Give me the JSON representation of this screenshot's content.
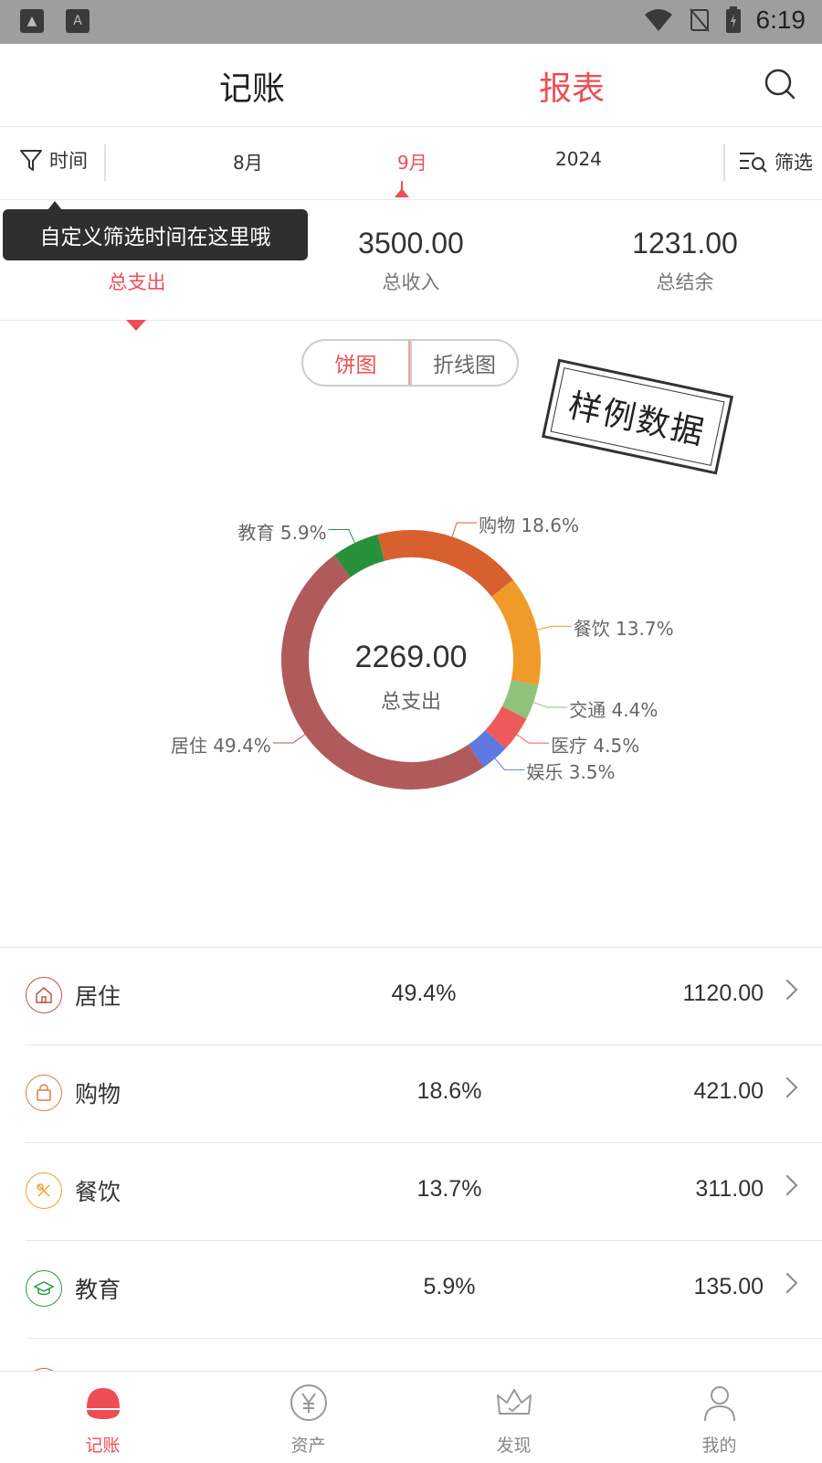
{
  "status_bar": {
    "time": "6:19"
  },
  "top_tabs": {
    "ledger": "记账",
    "report": "报表"
  },
  "filter_row": {
    "time_label": "时间",
    "periods": [
      {
        "label": "8月",
        "active": false
      },
      {
        "label": "9月",
        "active": true
      },
      {
        "label": "2024",
        "active": false
      }
    ],
    "filter_label": "筛选"
  },
  "tooltip": {
    "text": "自定义筛选时间在这里哦"
  },
  "summary": {
    "expense": {
      "value": "",
      "label": "总支出"
    },
    "income": {
      "value": "3500.00",
      "label": "总收入"
    },
    "balance": {
      "value": "1231.00",
      "label": "总结余"
    }
  },
  "chart_toggle": {
    "pie": "饼图",
    "line": "折线图"
  },
  "stamp": {
    "text": "样例数据"
  },
  "chart_data": {
    "type": "pie",
    "center_value": "2269.00",
    "center_label": "总支出",
    "slices": [
      {
        "name": "购物",
        "percent": 18.6,
        "label": "购物 18.6%",
        "color": "#d8602f"
      },
      {
        "name": "餐饮",
        "percent": 13.7,
        "label": "餐饮 13.7%",
        "color": "#f09a2a"
      },
      {
        "name": "交通",
        "percent": 4.4,
        "label": "交通 4.4%",
        "color": "#8fc27a"
      },
      {
        "name": "医疗",
        "percent": 4.5,
        "label": "医疗 4.5%",
        "color": "#ee5a5a"
      },
      {
        "name": "娱乐",
        "percent": 3.5,
        "label": "娱乐 3.5%",
        "color": "#6079e0"
      },
      {
        "name": "居住",
        "percent": 49.4,
        "label": "居住 49.4%",
        "color": "#b05a5c"
      },
      {
        "name": "教育",
        "percent": 5.9,
        "label": "教育 5.9%",
        "color": "#27913a"
      }
    ]
  },
  "list": [
    {
      "name": "居住",
      "percent": "49.4%",
      "amount": "1120.00",
      "color": "#c0524f",
      "icon": "home-icon"
    },
    {
      "name": "购物",
      "percent": "18.6%",
      "amount": "421.00",
      "color": "#e07a4a",
      "icon": "shopping-bag-icon"
    },
    {
      "name": "餐饮",
      "percent": "13.7%",
      "amount": "311.00",
      "color": "#f0a030",
      "icon": "utensils-icon"
    },
    {
      "name": "教育",
      "percent": "5.9%",
      "amount": "135.00",
      "color": "#2e9a48",
      "icon": "graduation-cap-icon"
    }
  ],
  "bottom_nav": [
    {
      "label": "记账",
      "icon": "ledger-icon",
      "active": true
    },
    {
      "label": "资产",
      "icon": "yen-icon",
      "active": false
    },
    {
      "label": "发现",
      "icon": "crown-icon",
      "active": false
    },
    {
      "label": "我的",
      "icon": "user-icon",
      "active": false
    }
  ],
  "colors": {
    "accent": "#ef4d55"
  }
}
